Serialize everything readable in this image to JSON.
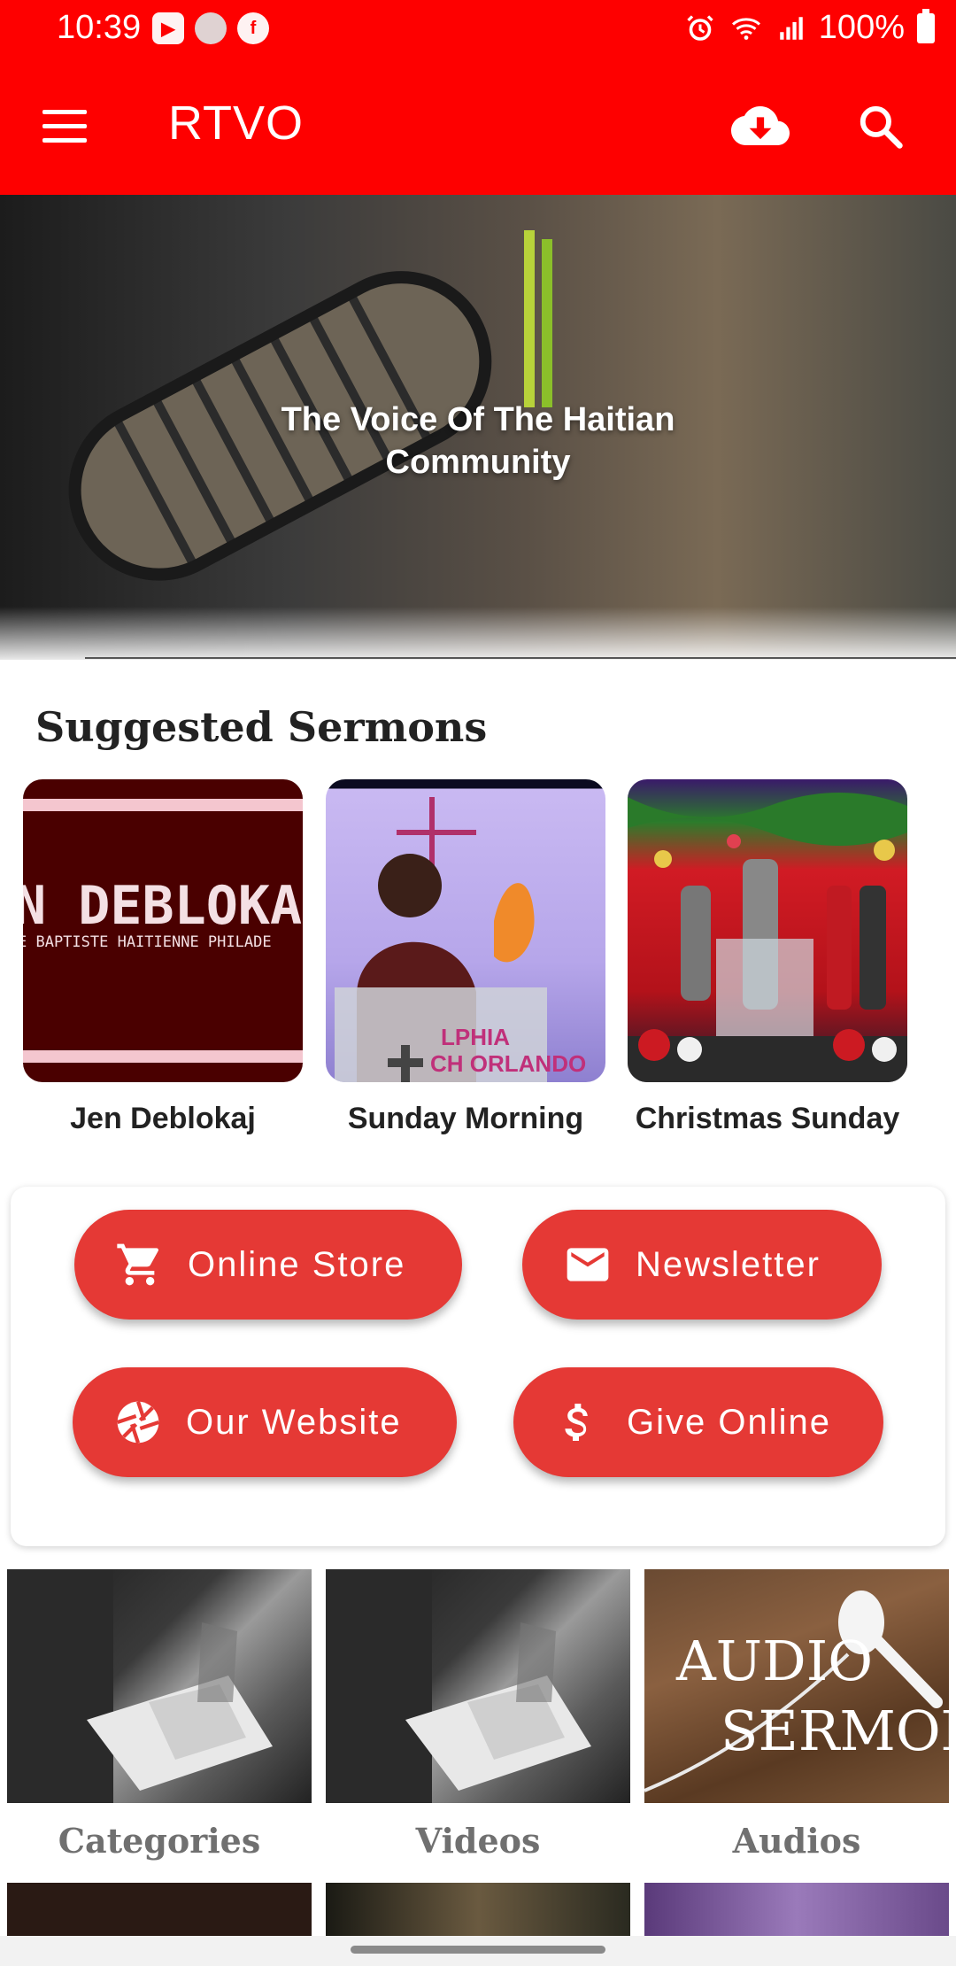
{
  "status_bar": {
    "time": "10:39",
    "battery": "100%",
    "left_icons": [
      "youtube-icon",
      "app-icon",
      "facebook-icon"
    ],
    "right_icons": [
      "alarm-icon",
      "wifi-icon",
      "signal-icon",
      "battery-icon"
    ]
  },
  "app_bar": {
    "title": "RTVO",
    "background": "#fe0000",
    "icons": [
      "menu-icon",
      "cloud-download-icon",
      "search-icon"
    ]
  },
  "hero": {
    "tagline": "The Voice Of The Haitian Community"
  },
  "suggested": {
    "title": "Suggested Sermons",
    "items": [
      {
        "label": "Jen Deblokaj",
        "thumb_text_1": "N DEBLOKA",
        "thumb_text_2": "E BAPTISTE HAITIENNE PHILADE"
      },
      {
        "label": "Sunday Morning",
        "thumb_text_1": "LPHIA",
        "thumb_text_2": "CH ORLANDO"
      },
      {
        "label": "Christmas Sunday"
      }
    ]
  },
  "actions": {
    "accent": "#e53935",
    "buttons": [
      {
        "label": "Online Store",
        "icon": "cart-icon"
      },
      {
        "label": "Newsletter",
        "icon": "mail-icon"
      },
      {
        "label": "Our Website",
        "icon": "aperture-icon"
      },
      {
        "label": "Give Online",
        "icon": "dollar-icon"
      }
    ]
  },
  "tiles": [
    {
      "label": "Categories"
    },
    {
      "label": "Videos"
    },
    {
      "label": "Audios",
      "image_text_1": "AUDIO",
      "image_text_2": "SERMONS"
    }
  ]
}
